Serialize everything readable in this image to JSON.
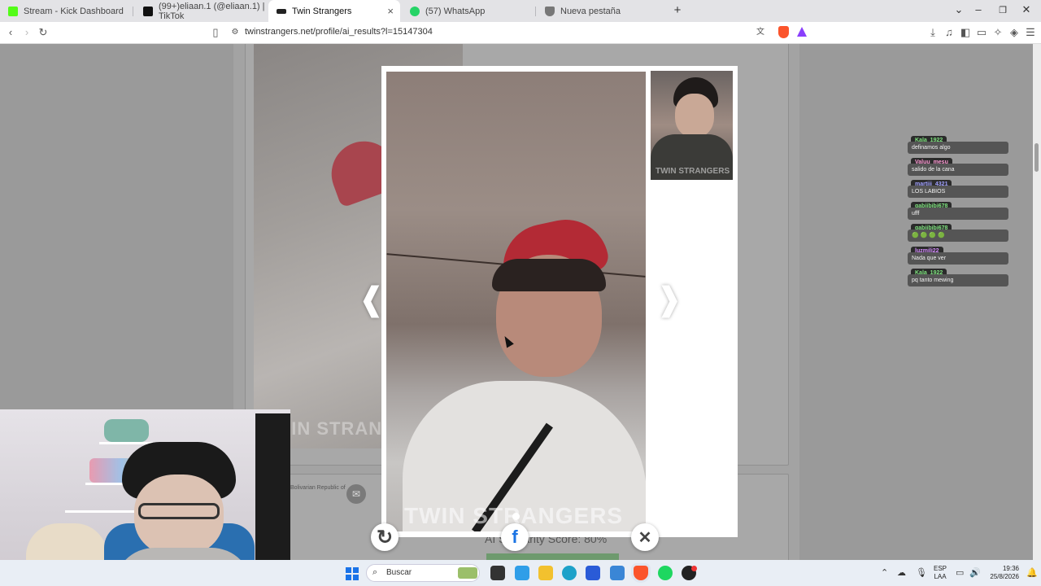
{
  "browser": {
    "tabs": [
      {
        "title": "Stream - Kick Dashboard",
        "color": "#53fc18"
      },
      {
        "title": "(99+)eliaan.1 (@eliaan.1) | TikTok",
        "color": "#111111"
      },
      {
        "title": "Twin Strangers",
        "color": "#222222"
      },
      {
        "title": "(57) WhatsApp",
        "color": "#25d366"
      },
      {
        "title": "Nueva pestaña",
        "color": "#555555"
      }
    ],
    "url": "twinstrangers.net/profile/ai_results?l=15147304",
    "new_tab_icon": "+",
    "tab_close_icon": "×"
  },
  "page": {
    "country_text": "Bolivarian Republic of",
    "watermark": "TWIN STRANGERS",
    "ai_score_text": "AI Similarity Score: 80%"
  },
  "modal": {
    "prev_arrow": "❰",
    "next_arrow": "❱",
    "main_watermark": "TWIN STRANGERS",
    "thumb_watermark": "TWIN STRANGERS",
    "refresh_icon": "↻",
    "facebook_icon": "f",
    "close_icon": "✕"
  },
  "chat": [
    {
      "user": "Kala_1922",
      "message": "definamos algo",
      "user_color": "#7ee27e"
    },
    {
      "user": "Valuu_mesu",
      "message": "salido de la cana",
      "user_color": "#ff9ad5"
    },
    {
      "user": "martiii_4321",
      "message": "LOS LABIOS",
      "user_color": "#a0a0ff"
    },
    {
      "user": "gabiibibi678",
      "message": "ufff",
      "user_color": "#7ee27e"
    },
    {
      "user": "gabiibibi678",
      "message": "🟢 🟢 🟢 🟢",
      "user_color": "#7ee27e"
    },
    {
      "user": "luzmili22",
      "message": "Nada que ver",
      "user_color": "#d68cff"
    },
    {
      "user": "Kala_1922",
      "message": "pq tanto mewing",
      "user_color": "#7ee27e"
    }
  ],
  "taskbar": {
    "search_placeholder": "Buscar",
    "lang_top": "ESP",
    "lang_bottom": "LAA",
    "time": "19:36",
    "date": "25/8/2026"
  }
}
